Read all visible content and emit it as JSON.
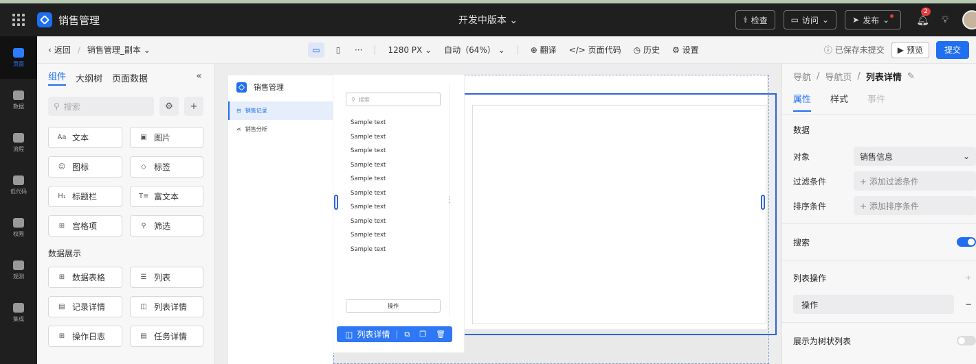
{
  "topbar": {
    "app_title": "销售管理",
    "version": "开发中版本",
    "check": "检查",
    "visit": "访问",
    "publish": "发布",
    "notifications": "2"
  },
  "leftnav": [
    {
      "label": "页面",
      "icon": "page-icon",
      "active": true
    },
    {
      "label": "数据",
      "icon": "database-icon"
    },
    {
      "label": "流程",
      "icon": "flow-icon"
    },
    {
      "label": "低代码",
      "icon": "code-icon"
    },
    {
      "label": "权限",
      "icon": "users-icon"
    },
    {
      "label": "观测",
      "icon": "monitor-icon"
    },
    {
      "label": "集成",
      "icon": "key-icon"
    }
  ],
  "subbar": {
    "back": "返回",
    "page_name": "销售管理_副本",
    "width": "1280 PX",
    "zoom": "自动（64%）",
    "translate": "翻译",
    "page_code": "页面代码",
    "history": "历史",
    "settings": "设置",
    "save_status": "已保存未提交",
    "preview": "预览",
    "submit": "提交"
  },
  "components": {
    "tabs": [
      "组件",
      "大纲树",
      "页面数据"
    ],
    "search_placeholder": "搜索",
    "basic": [
      {
        "label": "文本",
        "glyph": "Aa"
      },
      {
        "label": "图片",
        "glyph": "▣"
      },
      {
        "label": "图标",
        "glyph": "☺"
      },
      {
        "label": "标签",
        "glyph": "◇"
      },
      {
        "label": "标题栏",
        "glyph": "H₁"
      },
      {
        "label": "富文本",
        "glyph": "T≡"
      },
      {
        "label": "宫格项",
        "glyph": "⊞"
      },
      {
        "label": "筛选",
        "glyph": "⚲"
      }
    ],
    "section": "数据展示",
    "data_display": [
      {
        "label": "数据表格",
        "glyph": "⊞"
      },
      {
        "label": "列表",
        "glyph": "☰"
      },
      {
        "label": "记录详情",
        "glyph": "▤"
      },
      {
        "label": "列表详情",
        "glyph": "◫"
      },
      {
        "label": "操作日志",
        "glyph": "⊞"
      },
      {
        "label": "任务详情",
        "glyph": "▤"
      }
    ]
  },
  "canvas": {
    "brand": "销售管理",
    "nav": [
      {
        "label": "销售记录",
        "active": true
      },
      {
        "label": "销售分析"
      }
    ],
    "list_search": "搜索",
    "list_items": [
      "Sample text",
      "Sample text",
      "Sample text",
      "Sample text",
      "Sample text",
      "Sample text",
      "Sample text",
      "Sample text",
      "Sample text",
      "Sample text"
    ],
    "list_action": "操作",
    "selection_label": "列表详情"
  },
  "rightpanel": {
    "breadcrumb": [
      "导航",
      "导航页",
      "列表详情"
    ],
    "tabs": [
      "属性",
      "样式",
      "事件"
    ],
    "data_title": "数据",
    "object_label": "对象",
    "object_value": "销售信息",
    "filter_label": "过滤条件",
    "filter_add": "添加过滤条件",
    "sort_label": "排序条件",
    "sort_add": "添加排序条件",
    "search_label": "搜索",
    "list_ops_title": "列表操作",
    "list_op": "操作",
    "tree_label": "展示为树状列表"
  }
}
